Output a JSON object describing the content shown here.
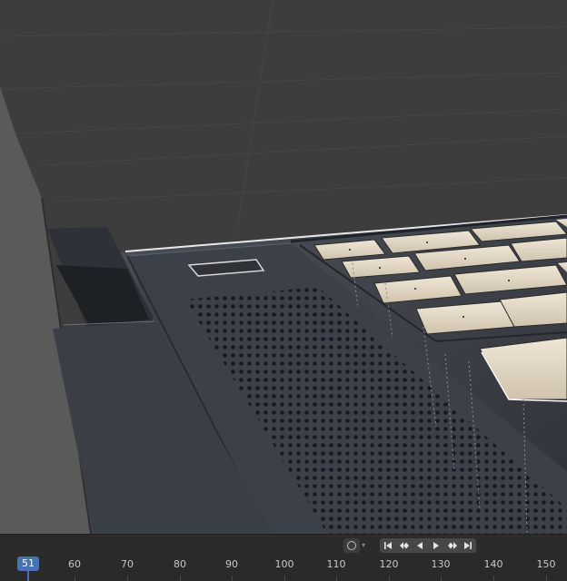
{
  "viewport": {
    "scene": "laptop-keyboard-render",
    "background_color": "#3d3d3d"
  },
  "timeline": {
    "current_frame": "51",
    "ruler_labels": [
      "60",
      "70",
      "80",
      "90",
      "100",
      "110",
      "120",
      "130",
      "140",
      "150"
    ],
    "playhead_color": "#4772b3",
    "controls": {
      "keying_icon": "record-circle-icon",
      "jump_start_icon": "jump-to-start-icon",
      "prev_keyframe_icon": "previous-keyframe-icon",
      "play_reverse_icon": "play-reverse-icon",
      "play_icon": "play-icon",
      "next_keyframe_icon": "next-keyframe-icon",
      "jump_end_icon": "jump-to-end-icon"
    }
  }
}
